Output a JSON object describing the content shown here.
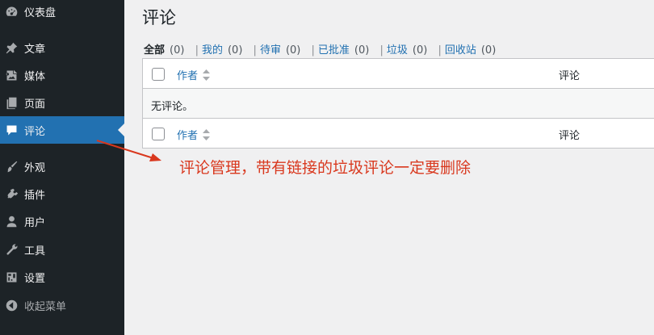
{
  "sidebar": {
    "items": [
      {
        "label": "仪表盘",
        "icon": "dashboard-icon"
      },
      {
        "label": "文章",
        "icon": "pushpin-icon"
      },
      {
        "label": "媒体",
        "icon": "media-icon"
      },
      {
        "label": "页面",
        "icon": "pages-icon"
      },
      {
        "label": "评论",
        "icon": "comment-icon",
        "active": true
      },
      {
        "label": "外观",
        "icon": "brush-icon"
      },
      {
        "label": "插件",
        "icon": "plugin-icon"
      },
      {
        "label": "用户",
        "icon": "user-icon"
      },
      {
        "label": "工具",
        "icon": "wrench-icon"
      },
      {
        "label": "设置",
        "icon": "settings-icon"
      },
      {
        "label": "收起菜单",
        "icon": "collapse-icon"
      }
    ]
  },
  "page": {
    "title": "评论"
  },
  "filters": [
    {
      "label": "全部",
      "count": "(0)",
      "current": true
    },
    {
      "label": "我的",
      "count": "(0)"
    },
    {
      "label": "待审",
      "count": "(0)"
    },
    {
      "label": "已批准",
      "count": "(0)"
    },
    {
      "label": "垃圾",
      "count": "(0)"
    },
    {
      "label": "回收站",
      "count": "(0)"
    }
  ],
  "filter_separator": "|",
  "table": {
    "col_author": "作者",
    "col_comment": "评论",
    "no_items": "无评论。"
  },
  "annotation": {
    "text": "评论管理，带有链接的垃圾评论一定要删除",
    "color": "#d9381e"
  },
  "colors": {
    "sidebar_bg": "#1d2327",
    "active_bg": "#2271b1",
    "link": "#2271b1",
    "page_bg": "#f0f0f1"
  }
}
